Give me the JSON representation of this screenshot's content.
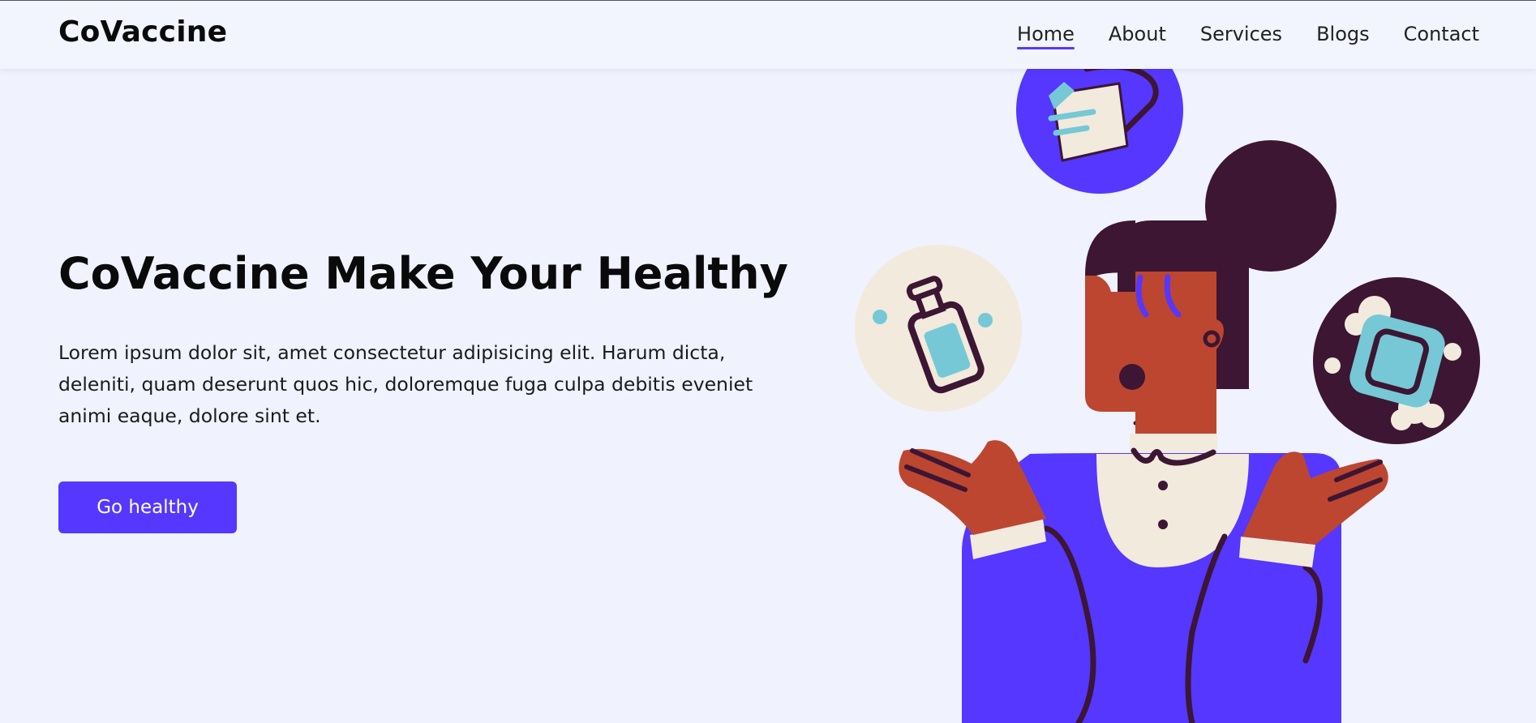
{
  "header": {
    "logo": "CoVaccine",
    "nav": [
      {
        "label": "Home",
        "active": true
      },
      {
        "label": "About",
        "active": false
      },
      {
        "label": "Services",
        "active": false
      },
      {
        "label": "Blogs",
        "active": false
      },
      {
        "label": "Contact",
        "active": false
      }
    ]
  },
  "hero": {
    "title": "CoVaccine Make Your Healthy",
    "description": "Lorem ipsum dolor sit, amet consectetur adipisicing elit. Harum dicta, deleniti, quam deserunt quos hic, doloremque fuga culpa debitis eveniet animi eaque, dolore sint et.",
    "cta_label": "Go healthy"
  },
  "colors": {
    "background": "#f0f2fe",
    "accent": "#5537ff",
    "hair": "#3c1632",
    "skin": "#bd4630",
    "cream": "#f2eadd",
    "teal": "#76c8d6"
  },
  "icons": [
    "face-mask-icon",
    "sanitizer-bottle-icon",
    "soap-bar-icon",
    "person-illustration"
  ]
}
